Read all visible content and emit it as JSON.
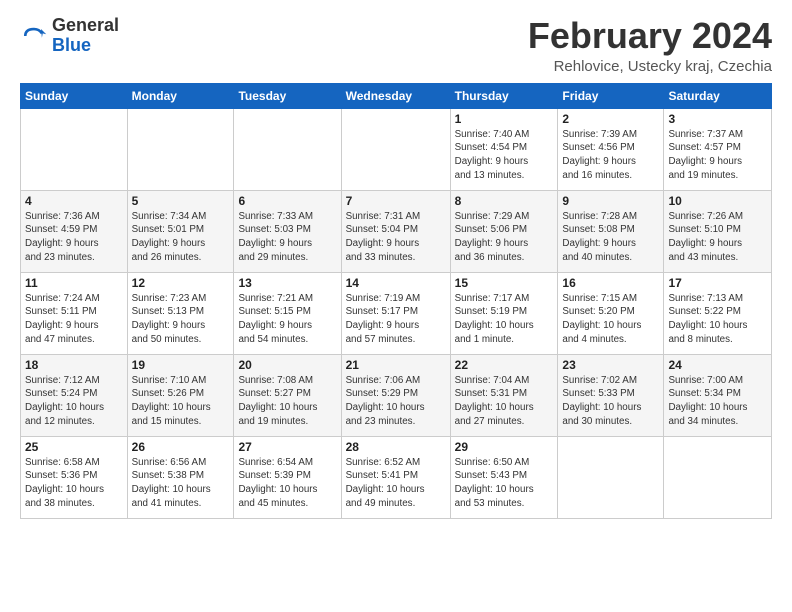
{
  "logo": {
    "general": "General",
    "blue": "Blue"
  },
  "header": {
    "month": "February 2024",
    "location": "Rehlovice, Ustecky kraj, Czechia"
  },
  "weekdays": [
    "Sunday",
    "Monday",
    "Tuesday",
    "Wednesday",
    "Thursday",
    "Friday",
    "Saturday"
  ],
  "weeks": [
    [
      {
        "day": "",
        "info": ""
      },
      {
        "day": "",
        "info": ""
      },
      {
        "day": "",
        "info": ""
      },
      {
        "day": "",
        "info": ""
      },
      {
        "day": "1",
        "info": "Sunrise: 7:40 AM\nSunset: 4:54 PM\nDaylight: 9 hours\nand 13 minutes."
      },
      {
        "day": "2",
        "info": "Sunrise: 7:39 AM\nSunset: 4:56 PM\nDaylight: 9 hours\nand 16 minutes."
      },
      {
        "day": "3",
        "info": "Sunrise: 7:37 AM\nSunset: 4:57 PM\nDaylight: 9 hours\nand 19 minutes."
      }
    ],
    [
      {
        "day": "4",
        "info": "Sunrise: 7:36 AM\nSunset: 4:59 PM\nDaylight: 9 hours\nand 23 minutes."
      },
      {
        "day": "5",
        "info": "Sunrise: 7:34 AM\nSunset: 5:01 PM\nDaylight: 9 hours\nand 26 minutes."
      },
      {
        "day": "6",
        "info": "Sunrise: 7:33 AM\nSunset: 5:03 PM\nDaylight: 9 hours\nand 29 minutes."
      },
      {
        "day": "7",
        "info": "Sunrise: 7:31 AM\nSunset: 5:04 PM\nDaylight: 9 hours\nand 33 minutes."
      },
      {
        "day": "8",
        "info": "Sunrise: 7:29 AM\nSunset: 5:06 PM\nDaylight: 9 hours\nand 36 minutes."
      },
      {
        "day": "9",
        "info": "Sunrise: 7:28 AM\nSunset: 5:08 PM\nDaylight: 9 hours\nand 40 minutes."
      },
      {
        "day": "10",
        "info": "Sunrise: 7:26 AM\nSunset: 5:10 PM\nDaylight: 9 hours\nand 43 minutes."
      }
    ],
    [
      {
        "day": "11",
        "info": "Sunrise: 7:24 AM\nSunset: 5:11 PM\nDaylight: 9 hours\nand 47 minutes."
      },
      {
        "day": "12",
        "info": "Sunrise: 7:23 AM\nSunset: 5:13 PM\nDaylight: 9 hours\nand 50 minutes."
      },
      {
        "day": "13",
        "info": "Sunrise: 7:21 AM\nSunset: 5:15 PM\nDaylight: 9 hours\nand 54 minutes."
      },
      {
        "day": "14",
        "info": "Sunrise: 7:19 AM\nSunset: 5:17 PM\nDaylight: 9 hours\nand 57 minutes."
      },
      {
        "day": "15",
        "info": "Sunrise: 7:17 AM\nSunset: 5:19 PM\nDaylight: 10 hours\nand 1 minute."
      },
      {
        "day": "16",
        "info": "Sunrise: 7:15 AM\nSunset: 5:20 PM\nDaylight: 10 hours\nand 4 minutes."
      },
      {
        "day": "17",
        "info": "Sunrise: 7:13 AM\nSunset: 5:22 PM\nDaylight: 10 hours\nand 8 minutes."
      }
    ],
    [
      {
        "day": "18",
        "info": "Sunrise: 7:12 AM\nSunset: 5:24 PM\nDaylight: 10 hours\nand 12 minutes."
      },
      {
        "day": "19",
        "info": "Sunrise: 7:10 AM\nSunset: 5:26 PM\nDaylight: 10 hours\nand 15 minutes."
      },
      {
        "day": "20",
        "info": "Sunrise: 7:08 AM\nSunset: 5:27 PM\nDaylight: 10 hours\nand 19 minutes."
      },
      {
        "day": "21",
        "info": "Sunrise: 7:06 AM\nSunset: 5:29 PM\nDaylight: 10 hours\nand 23 minutes."
      },
      {
        "day": "22",
        "info": "Sunrise: 7:04 AM\nSunset: 5:31 PM\nDaylight: 10 hours\nand 27 minutes."
      },
      {
        "day": "23",
        "info": "Sunrise: 7:02 AM\nSunset: 5:33 PM\nDaylight: 10 hours\nand 30 minutes."
      },
      {
        "day": "24",
        "info": "Sunrise: 7:00 AM\nSunset: 5:34 PM\nDaylight: 10 hours\nand 34 minutes."
      }
    ],
    [
      {
        "day": "25",
        "info": "Sunrise: 6:58 AM\nSunset: 5:36 PM\nDaylight: 10 hours\nand 38 minutes."
      },
      {
        "day": "26",
        "info": "Sunrise: 6:56 AM\nSunset: 5:38 PM\nDaylight: 10 hours\nand 41 minutes."
      },
      {
        "day": "27",
        "info": "Sunrise: 6:54 AM\nSunset: 5:39 PM\nDaylight: 10 hours\nand 45 minutes."
      },
      {
        "day": "28",
        "info": "Sunrise: 6:52 AM\nSunset: 5:41 PM\nDaylight: 10 hours\nand 49 minutes."
      },
      {
        "day": "29",
        "info": "Sunrise: 6:50 AM\nSunset: 5:43 PM\nDaylight: 10 hours\nand 53 minutes."
      },
      {
        "day": "",
        "info": ""
      },
      {
        "day": "",
        "info": ""
      }
    ]
  ]
}
